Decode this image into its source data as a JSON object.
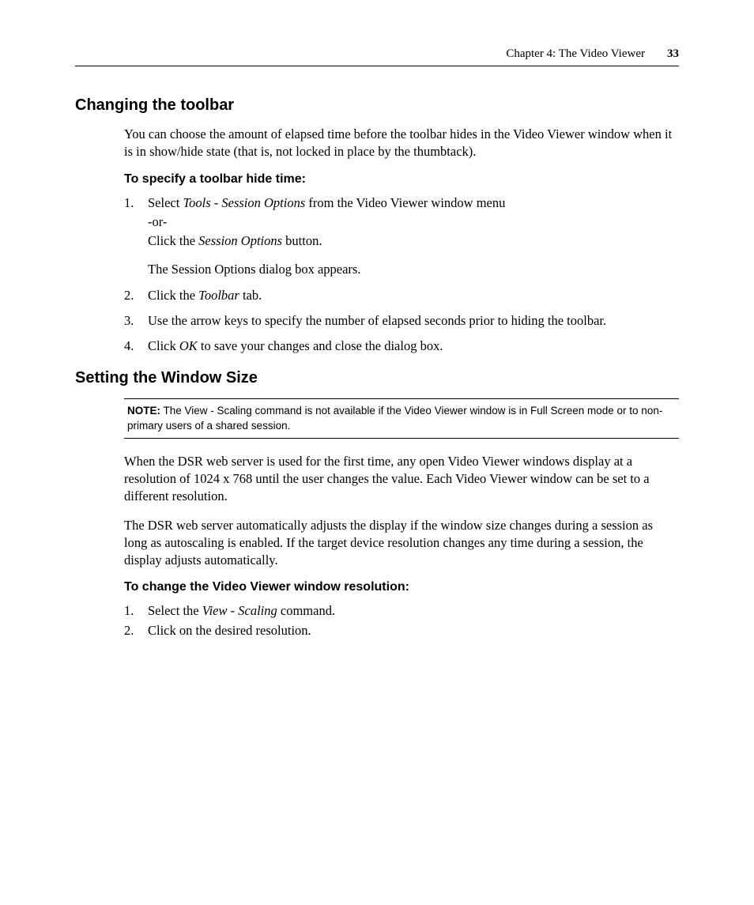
{
  "header": {
    "chapter": "Chapter 4: The Video Viewer",
    "page_number": "33"
  },
  "section1": {
    "title": "Changing the toolbar",
    "intro": "You can choose the amount of elapsed time before the toolbar hides in the Video Viewer window when it is in show/hide state (that is, not locked in place by the thumbtack).",
    "subhead": "To specify a toolbar hide time:",
    "steps": {
      "s1": {
        "num": "1.",
        "a": "Select ",
        "a_em": "Tools - Session Options",
        "a2": " from the Video Viewer window menu",
        "b": "-or-",
        "c1": "Click the ",
        "c_em": "Session Options",
        "c2": " button.",
        "d": "The Session Options dialog box appears."
      },
      "s2": {
        "num": "2.",
        "a1": "Click the ",
        "a_em": "Toolbar",
        "a2": " tab."
      },
      "s3": {
        "num": "3.",
        "a": "Use the arrow keys to specify the number of elapsed seconds prior to hiding the toolbar."
      },
      "s4": {
        "num": "4.",
        "a1": "Click ",
        "a_em": "OK",
        "a2": " to save your changes and close the dialog box."
      }
    }
  },
  "section2": {
    "title": "Setting the Window Size",
    "note_label": "NOTE:",
    "note_text": " The View - Scaling command is not available if the Video Viewer window is in Full Screen mode or to non-primary users of a shared session.",
    "p1": "When the DSR web server is used for the first time, any open Video Viewer windows display at a resolution of 1024 x 768 until the user changes the value. Each Video Viewer window can be set to a different resolution.",
    "p2": "The DSR web server automatically adjusts the display if the window size changes during a session as long as autoscaling is enabled. If the target device resolution changes any time during a session, the display adjusts automatically.",
    "subhead": "To change the Video Viewer window resolution:",
    "steps": {
      "s1": {
        "num": "1.",
        "a1": "Select the ",
        "a_em": "View - Scaling",
        "a2": " command."
      },
      "s2": {
        "num": "2.",
        "a": "Click on the desired resolution."
      }
    }
  }
}
